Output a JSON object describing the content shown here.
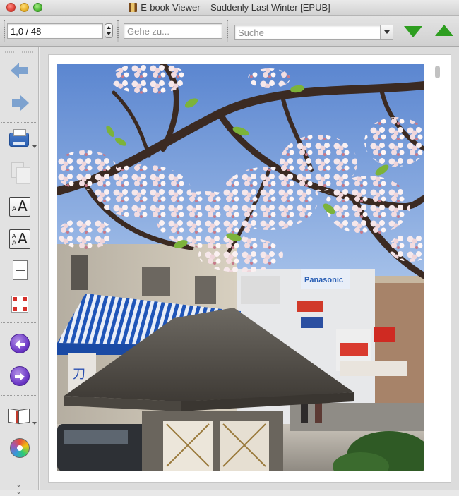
{
  "window": {
    "title": "E-book Viewer – Suddenly Last Winter [EPUB]"
  },
  "toolbar": {
    "page_position": "1,0 / 48",
    "goto_placeholder": "Gehe zu...",
    "search_placeholder": "Suche",
    "next_match_icon": "green-triangle-down-icon",
    "prev_match_icon": "green-triangle-up-icon"
  },
  "sidebar": {
    "items": [
      {
        "name": "back",
        "icon": "arrow-left-icon"
      },
      {
        "name": "forward",
        "icon": "arrow-right-icon"
      },
      {
        "name": "print",
        "icon": "printer-icon"
      },
      {
        "name": "copy",
        "icon": "copy-icon"
      },
      {
        "name": "font-larger",
        "icon": "font-larger-icon"
      },
      {
        "name": "font-smaller",
        "icon": "font-smaller-icon"
      },
      {
        "name": "table-of-contents",
        "icon": "toc-icon"
      },
      {
        "name": "fullscreen",
        "icon": "fullscreen-icon"
      },
      {
        "name": "previous-page",
        "icon": "previous-page-icon"
      },
      {
        "name": "next-page",
        "icon": "next-page-icon"
      },
      {
        "name": "reference-mode",
        "icon": "book-icon"
      },
      {
        "name": "preferences",
        "icon": "preferences-icon"
      }
    ]
  },
  "content": {
    "page_image": "cherry blossom tree above a stone lantern roof, street with shop signs below"
  },
  "colors": {
    "accent_green": "#2e9e20",
    "nav_blue": "#7da2cf",
    "nav_purple": "#6b37c6"
  }
}
